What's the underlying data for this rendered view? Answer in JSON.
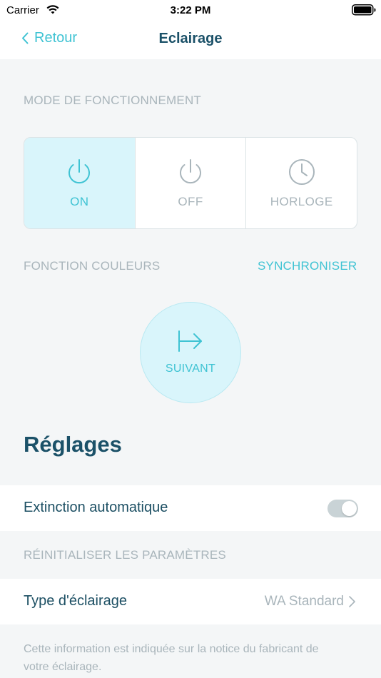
{
  "status_bar": {
    "carrier": "Carrier",
    "time": "3:22 PM"
  },
  "nav": {
    "back_label": "Retour",
    "title": "Eclairage"
  },
  "mode_section": {
    "label": "MODE DE FONCTIONNEMENT",
    "options": [
      {
        "label": "ON",
        "icon": "power-icon",
        "selected": true
      },
      {
        "label": "OFF",
        "icon": "power-icon",
        "selected": false
      },
      {
        "label": "HORLOGE",
        "icon": "clock-icon",
        "selected": false
      }
    ]
  },
  "color_section": {
    "label": "FONCTION COULEURS",
    "sync_label": "SYNCHRONISER",
    "next_label": "SUIVANT",
    "next_icon": "arrow-right-to-bar-icon"
  },
  "settings": {
    "title": "Réglages",
    "auto_off_label": "Extinction automatique",
    "auto_off_enabled": true,
    "reset_label": "RÉINITIALISER LES PARAMÈTRES",
    "lighting_type_label": "Type d'éclairage",
    "lighting_type_value": "WA Standard",
    "footnote": "Cette information est indiquée sur la notice du fabricant de votre éclairage."
  },
  "colors": {
    "accent": "#3fc3d3",
    "selected_bg": "#d9f5fb",
    "title": "#1b5168",
    "muted": "#a9b5bb"
  }
}
